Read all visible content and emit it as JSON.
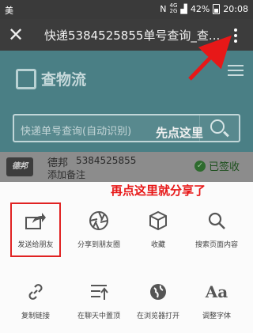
{
  "status_bar": {
    "left_text": "美",
    "signal": "4G\n2G",
    "battery": "42%",
    "time": "20:08"
  },
  "title_bar": {
    "title": "快递5384525855单号查询_查..."
  },
  "page": {
    "logo_text": "查物流",
    "search_placeholder": "快递单号查询(自动识别)",
    "result": {
      "courier_logo": "德邦",
      "courier": "德邦",
      "tracking_no": "5384525855",
      "note": "添加备注",
      "status": "已签收"
    }
  },
  "share_sheet": {
    "items": [
      {
        "label": "发送给朋友",
        "icon": "share-arrow-icon"
      },
      {
        "label": "分享到朋友圈",
        "icon": "moments-aperture-icon"
      },
      {
        "label": "收藏",
        "icon": "cube-icon"
      },
      {
        "label": "搜索页面内容",
        "icon": "search-icon"
      },
      {
        "label": "复制链接",
        "icon": "link-icon"
      },
      {
        "label": "在聊天中置顶",
        "icon": "pin-top-icon"
      },
      {
        "label": "在浏览器打开",
        "icon": "globe-icon"
      },
      {
        "label": "调整字体",
        "icon": "font-aa-icon"
      }
    ]
  },
  "annotations": {
    "first": "先点这里",
    "second": "再点这里就分享了"
  },
  "colors": {
    "annotation_red": "#e71818",
    "page_teal_dimmed": "#4a7f85",
    "toolbar": "#3c3c3c"
  }
}
